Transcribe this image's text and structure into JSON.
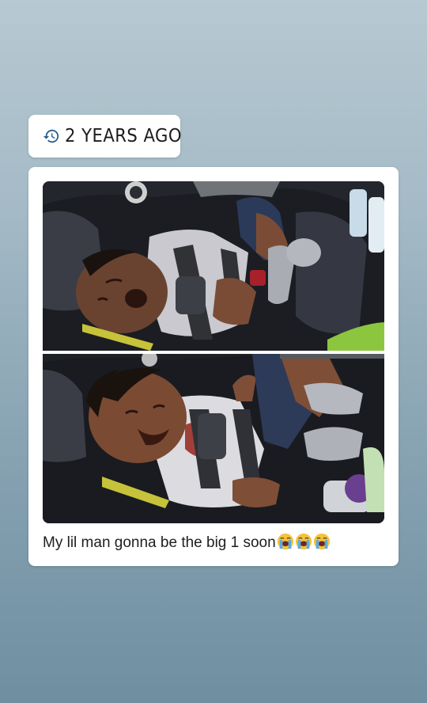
{
  "memory_badge": {
    "label": "2 YEARS AGO",
    "icon": "history-icon"
  },
  "post": {
    "caption": "My lil man gonna be the big 1 soon",
    "emojis": [
      "loudly-crying-face-icon",
      "loudly-crying-face-icon",
      "loudly-crying-face-icon"
    ],
    "photos": [
      {
        "description_icon": "photo-baby-yawning"
      },
      {
        "description_icon": "photo-baby-smiling"
      }
    ]
  },
  "colors": {
    "background_top": "#b7c9d2",
    "background_bottom": "#6f8fa1",
    "card": "#ffffff",
    "icon_blue": "#2b5d8f"
  }
}
